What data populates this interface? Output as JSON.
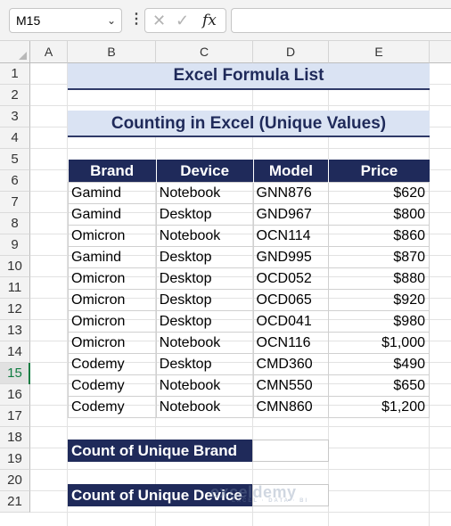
{
  "formula_bar": {
    "name_box": "M15",
    "fx_symbol": "fx",
    "formula": ""
  },
  "columns": [
    "A",
    "B",
    "C",
    "D",
    "E"
  ],
  "rows": [
    "1",
    "2",
    "3",
    "4",
    "5",
    "6",
    "7",
    "8",
    "9",
    "10",
    "11",
    "12",
    "13",
    "14",
    "15",
    "16",
    "17",
    "18",
    "19",
    "20",
    "21"
  ],
  "active_row": "15",
  "title1": "Excel Formula List",
  "title2": "Counting in Excel (Unique Values)",
  "table": {
    "headers": [
      "Brand",
      "Device",
      "Model",
      "Price"
    ],
    "rows": [
      [
        "Gamind",
        "Notebook",
        "GNN876",
        "$620"
      ],
      [
        "Gamind",
        "Desktop",
        "GND967",
        "$800"
      ],
      [
        "Omicron",
        "Notebook",
        "OCN114",
        "$860"
      ],
      [
        "Gamind",
        "Desktop",
        "GND995",
        "$870"
      ],
      [
        "Omicron",
        "Desktop",
        "OCD052",
        "$880"
      ],
      [
        "Omicron",
        "Desktop",
        "OCD065",
        "$920"
      ],
      [
        "Omicron",
        "Desktop",
        "OCD041",
        "$980"
      ],
      [
        "Omicron",
        "Notebook",
        "OCN116",
        "$1,000"
      ],
      [
        "Codemy",
        "Desktop",
        "CMD360",
        "$490"
      ],
      [
        "Codemy",
        "Notebook",
        "CMN550",
        "$650"
      ],
      [
        "Codemy",
        "Notebook",
        "CMN860",
        "$1,200"
      ]
    ]
  },
  "count_brand": {
    "label": "Count of Unique Brand",
    "value": ""
  },
  "count_device": {
    "label": "Count of Unique Device",
    "value": ""
  },
  "watermark": {
    "name": "exceldemy",
    "tagline": "EXCEL · DATA · BI"
  }
}
